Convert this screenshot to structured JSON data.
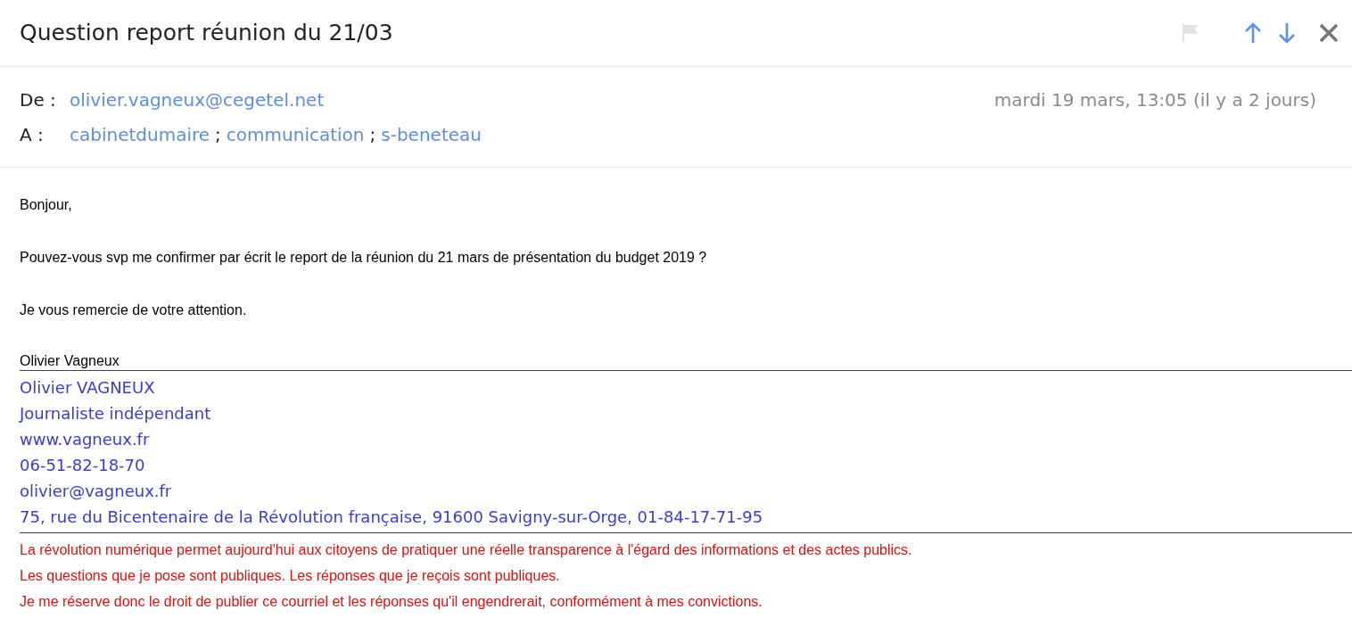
{
  "subject": "Question report réunion du 21/03",
  "toolbar": {
    "flagged": false
  },
  "from": {
    "label": "De :",
    "address": "olivier.vagneux@cegetel.net"
  },
  "to": {
    "label": "A :",
    "recipients": [
      {
        "name": "cabinetdumaire",
        "separator": ";"
      },
      {
        "name": "communication",
        "separator": ";"
      },
      {
        "name": "s-beneteau"
      }
    ]
  },
  "date": "mardi 19 mars, 13:05 (il y a 2 jours)",
  "body": [
    "Bonjour,",
    "Pouvez-vous svp me confirmer par écrit le report de la réunion du 21 mars de présentation du budget 2019 ?",
    "Je vous remercie de votre attention."
  ],
  "signature_name": "Olivier Vagneux",
  "signature_lines": [
    "Olivier VAGNEUX",
    "Journaliste indépendant",
    "www.vagneux.fr",
    "06-51-82-18-70",
    "olivier@vagneux.fr",
    "75, rue du Bicentenaire de la Révolution française, 91600 Savigny-sur-Orge, 01-84-17-71-95"
  ],
  "disclaimer": [
    "La révolution numérique permet aujourd'hui aux citoyens de pratiquer une réelle transparence à l'égard des informations et des actes publics.",
    "Les questions que je pose sont publiques. Les réponses que je reçois sont publiques.",
    "Je me réserve donc le droit de publier ce courriel et les réponses qu'il engendrerait, conformément à mes convictions."
  ]
}
